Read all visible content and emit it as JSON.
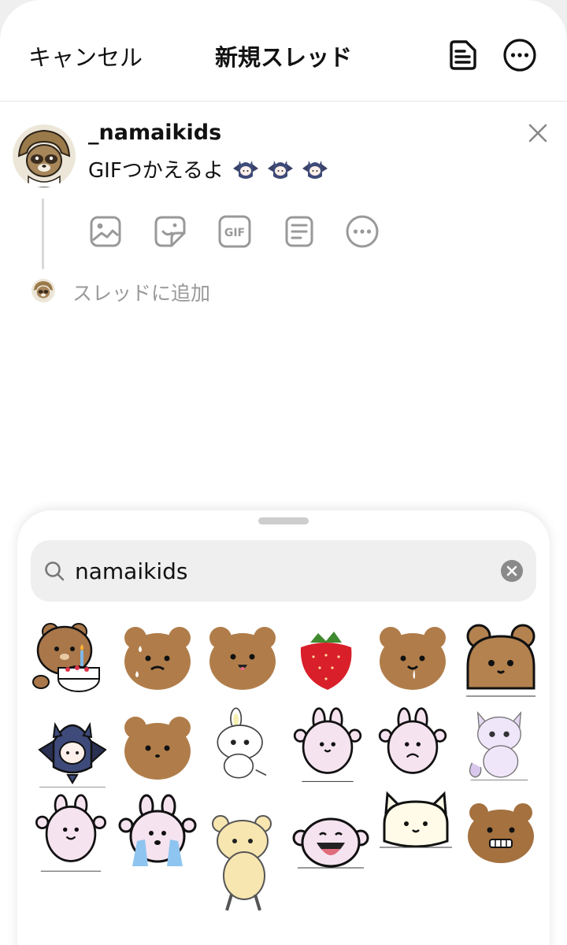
{
  "header": {
    "cancel_label": "キャンセル",
    "title": "新規スレッド",
    "drafts_icon": "drafts-icon",
    "more_icon": "more-icon"
  },
  "composer": {
    "username": "_namaikids",
    "post_text": "GIFつかえるよ",
    "tools": [
      "gallery-icon",
      "sticker-icon",
      "gif-icon",
      "poll-icon",
      "more-icon"
    ],
    "add_to_thread": "スレッドに追加"
  },
  "gif_picker": {
    "search_value": "namaikids",
    "stickers": [
      "brown-bear-with-cake",
      "fluffy-bear-crying",
      "fluffy-bear-smiling",
      "strawberry",
      "fluffy-bear-drooling",
      "brown-bear-outline",
      "bat-costume-girl",
      "fluffy-bear-plain",
      "white-bunny",
      "pink-bunny-waving",
      "pink-bunny-shy",
      "lavender-cat",
      "pink-bunny-happy",
      "pink-bunny-crying",
      "cream-bear-dancing",
      "pink-blob-laughing",
      "cream-cat",
      "fluffy-bear-grimace"
    ]
  }
}
